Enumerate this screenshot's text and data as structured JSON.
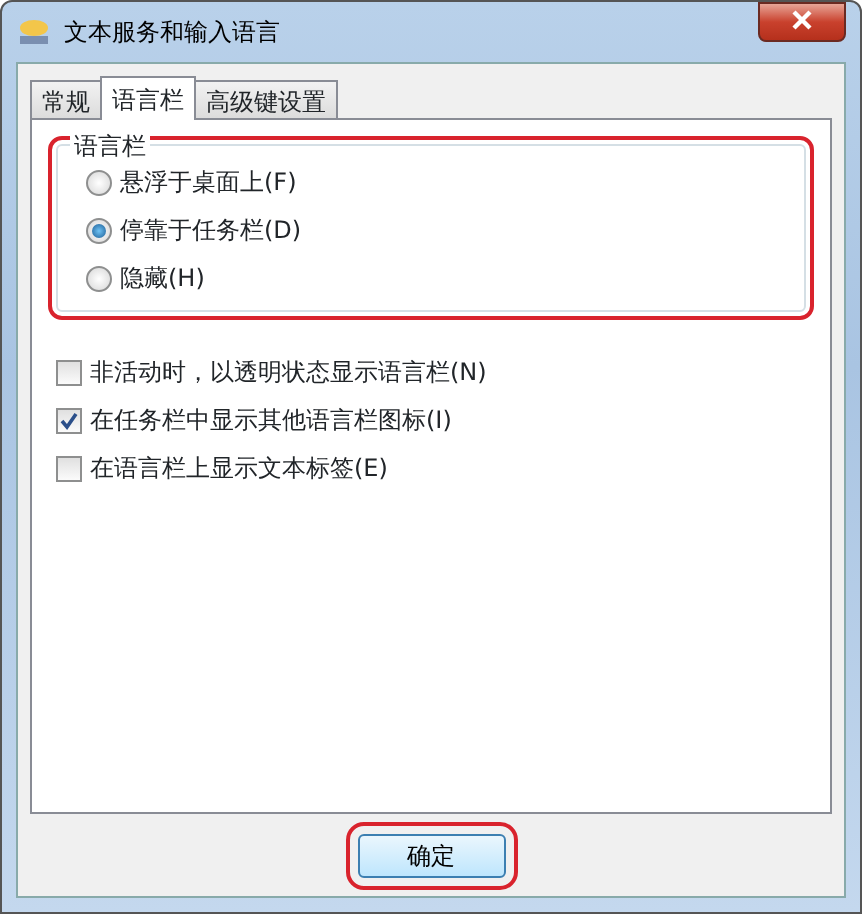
{
  "window": {
    "title": "文本服务和输入语言"
  },
  "tabs": [
    {
      "label": "常规",
      "selected": false
    },
    {
      "label": "语言栏",
      "selected": true
    },
    {
      "label": "高级键设置",
      "selected": false
    }
  ],
  "language_bar_group": {
    "title": "语言栏",
    "options": [
      {
        "label": "悬浮于桌面上(F)",
        "selected": false
      },
      {
        "label": "停靠于任务栏(D)",
        "selected": true
      },
      {
        "label": "隐藏(H)",
        "selected": false
      }
    ]
  },
  "checkboxes": [
    {
      "label": "非活动时，以透明状态显示语言栏(N)",
      "checked": false
    },
    {
      "label": "在任务栏中显示其他语言栏图标(I)",
      "checked": true
    },
    {
      "label": "在语言栏上显示文本标签(E)",
      "checked": false
    }
  ],
  "buttons": [
    {
      "label": "确定"
    }
  ]
}
